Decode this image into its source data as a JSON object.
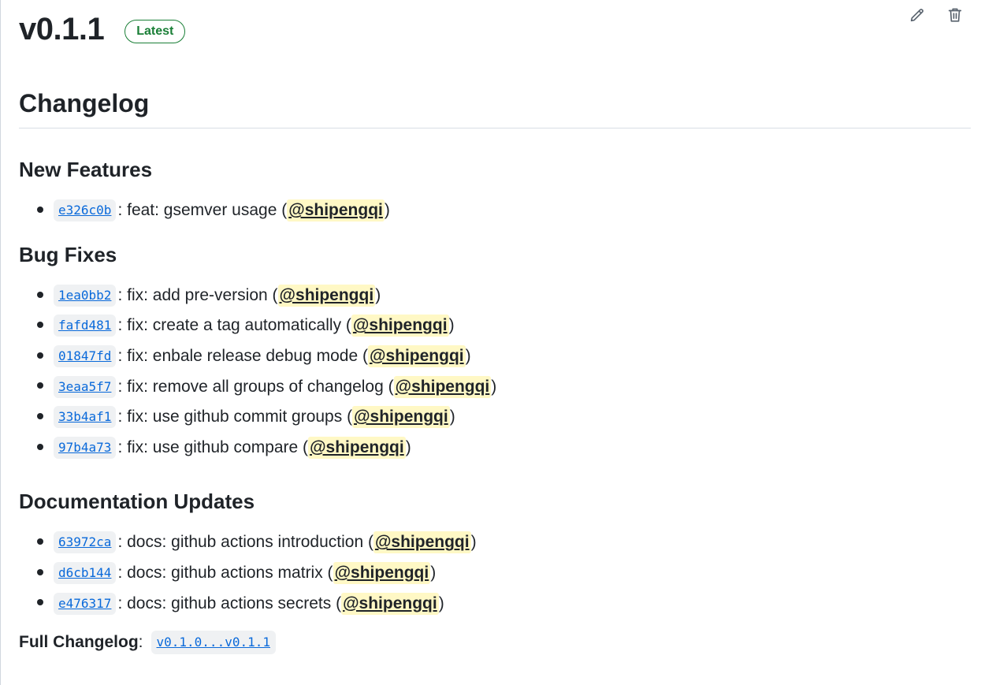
{
  "release": {
    "tag": "v0.1.1",
    "badge": "Latest"
  },
  "actions": {
    "edit_icon": "pencil-icon",
    "delete_icon": "trash-icon"
  },
  "body": {
    "heading": "Changelog",
    "sections": [
      {
        "title": "New Features",
        "items": [
          {
            "sha": "e326c0b",
            "message": ": feat: gsemver usage (",
            "author": "@shipengqi",
            "close": ")"
          }
        ]
      },
      {
        "title": "Bug Fixes",
        "items": [
          {
            "sha": "1ea0bb2",
            "message": ": fix: add pre-version (",
            "author": "@shipengqi",
            "close": ")"
          },
          {
            "sha": "fafd481",
            "message": ": fix: create a tag automatically (",
            "author": "@shipengqi",
            "close": ")"
          },
          {
            "sha": "01847fd",
            "message": ": fix: enbale release debug mode (",
            "author": "@shipengqi",
            "close": ")"
          },
          {
            "sha": "3eaa5f7",
            "message": ": fix: remove all groups of changelog (",
            "author": "@shipengqi",
            "close": ")"
          },
          {
            "sha": "33b4af1",
            "message": ": fix: use github commit groups (",
            "author": "@shipengqi",
            "close": ")"
          },
          {
            "sha": "97b4a73",
            "message": ": fix: use github compare (",
            "author": "@shipengqi",
            "close": ")"
          }
        ]
      },
      {
        "title": "Documentation Updates",
        "items": [
          {
            "sha": "63972ca",
            "message": ": docs: github actions introduction (",
            "author": "@shipengqi",
            "close": ")"
          },
          {
            "sha": "d6cb144",
            "message": ": docs: github actions matrix (",
            "author": "@shipengqi",
            "close": ")"
          },
          {
            "sha": "e476317",
            "message": ": docs: github actions secrets (",
            "author": "@shipengqi",
            "close": ")"
          }
        ]
      }
    ],
    "full_changelog": {
      "label": "Full Changelog",
      "separator": ":",
      "compare": "v0.1.0...v0.1.1"
    }
  },
  "colors": {
    "link": "#0969da",
    "badge_green": "#1a7f37",
    "mention_highlight": "#fff8c5",
    "code_bg": "#eff1f3"
  }
}
